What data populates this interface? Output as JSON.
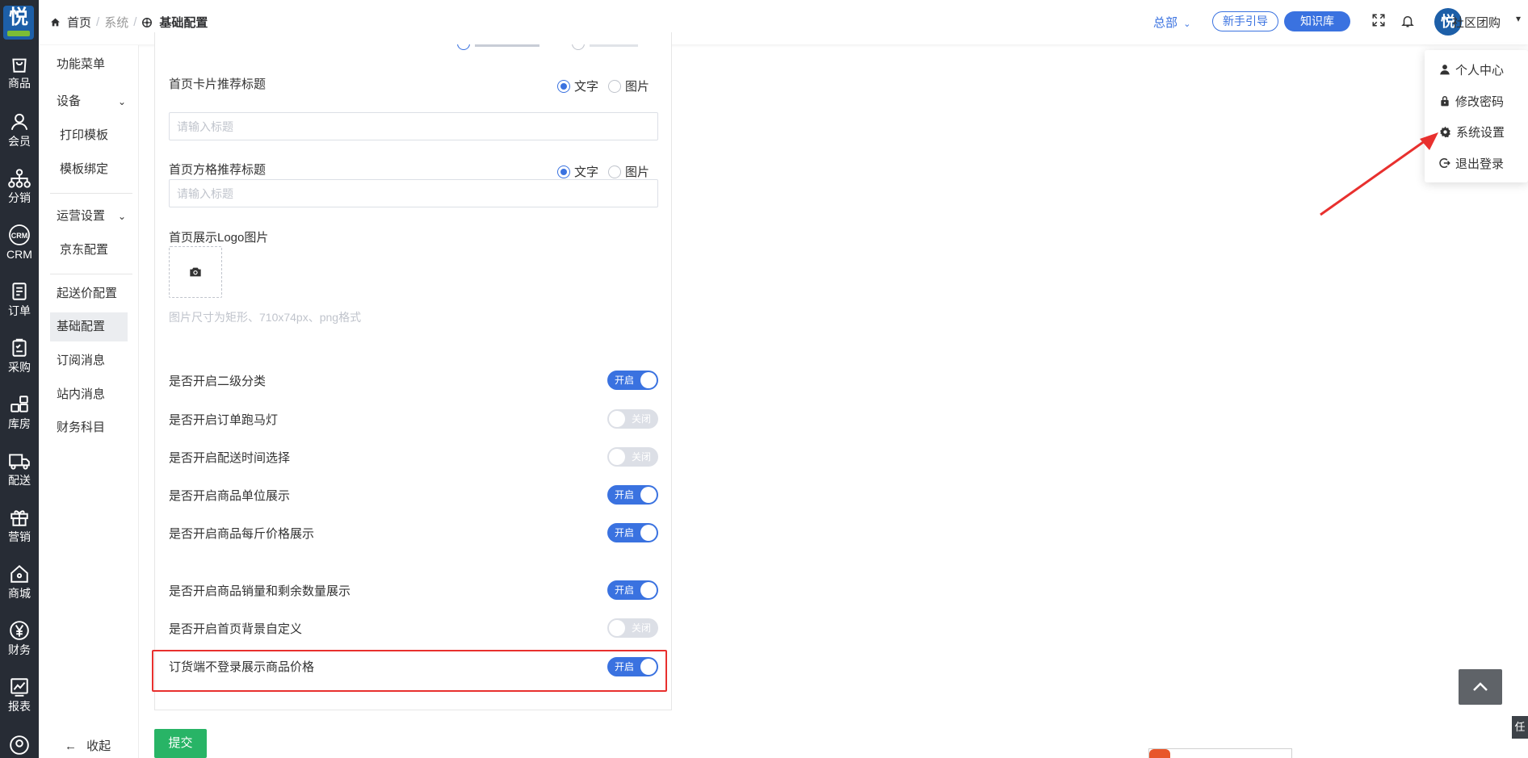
{
  "app": {
    "logo_text": "悦",
    "brand_color": "#1d5fa8",
    "accent_color": "#3a72e0",
    "rail_color": "#272c35"
  },
  "rail": {
    "items": [
      {
        "label": "商品",
        "icon": "bag-icon"
      },
      {
        "label": "会员",
        "icon": "user-icon"
      },
      {
        "label": "分销",
        "icon": "hierarchy-icon"
      },
      {
        "label": "CRM",
        "icon": "crm-icon"
      },
      {
        "label": "订单",
        "icon": "document-icon"
      },
      {
        "label": "采购",
        "icon": "clipboard-icon"
      },
      {
        "label": "库房",
        "icon": "grid-icon"
      },
      {
        "label": "配送",
        "icon": "truck-icon"
      },
      {
        "label": "营销",
        "icon": "gift-icon"
      },
      {
        "label": "商城",
        "icon": "home-icon"
      },
      {
        "label": "财务",
        "icon": "yen-icon"
      },
      {
        "label": "报表",
        "icon": "chart-icon"
      }
    ]
  },
  "submenu": {
    "items": [
      {
        "label": "功能菜单"
      },
      {
        "label": "设备"
      },
      {
        "label": "打印模板"
      },
      {
        "label": "模板绑定"
      },
      {
        "label": "运营设置"
      },
      {
        "label": "京东配置"
      },
      {
        "label": "起送价配置"
      },
      {
        "label": "基础配置"
      },
      {
        "label": "订阅消息"
      },
      {
        "label": "站内消息"
      },
      {
        "label": "财务科目"
      }
    ],
    "collapse_label": "收起"
  },
  "header": {
    "breadcrumb": [
      "首页",
      "系统",
      "基础配置"
    ],
    "store_select": "总部",
    "guide_button": "新手引导",
    "kb_button": "知识库",
    "user_name": "社区团购"
  },
  "dropdown": {
    "items": [
      {
        "label": "个人中心",
        "icon": "person-icon"
      },
      {
        "label": "修改密码",
        "icon": "lock-icon"
      },
      {
        "label": "系统设置",
        "icon": "gear-icon"
      },
      {
        "label": "退出登录",
        "icon": "logout-icon"
      }
    ]
  },
  "form": {
    "card_title": {
      "label": "首页卡片推荐标题",
      "options": [
        "文字",
        "图片"
      ],
      "selected": "文字",
      "placeholder": "请输入标题"
    },
    "grid_title": {
      "label": "首页方格推荐标题",
      "options": [
        "文字",
        "图片"
      ],
      "selected": "文字",
      "placeholder": "请输入标题"
    },
    "logo": {
      "label": "首页展示Logo图片",
      "hint": "图片尺寸为矩形、710x74px、png格式"
    },
    "toggles": [
      {
        "label": "是否开启二级分类",
        "state": "开启",
        "on": true
      },
      {
        "label": "是否开启订单跑马灯",
        "state": "关闭",
        "on": false
      },
      {
        "label": "是否开启配送时间选择",
        "state": "关闭",
        "on": false
      },
      {
        "label": "是否开启商品单位展示",
        "state": "开启",
        "on": true
      },
      {
        "label": "是否开启商品每斤价格展示",
        "state": "开启",
        "on": true
      },
      {
        "label": "是否开启商品销量和剩余数量展示",
        "state": "开启",
        "on": true
      },
      {
        "label": "是否开启首页背景自定义",
        "state": "关闭",
        "on": false
      },
      {
        "label": "订货端不登录展示商品价格",
        "state": "开启",
        "on": true
      }
    ],
    "submit_label": "提交"
  },
  "edge_tag": "任"
}
